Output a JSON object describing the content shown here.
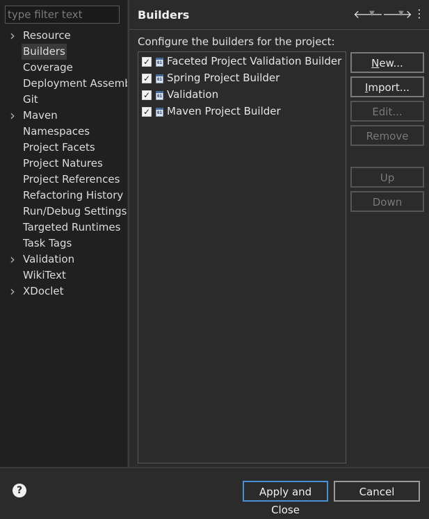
{
  "filter": {
    "placeholder": "type filter text"
  },
  "tree": {
    "items": [
      {
        "label": "Resource",
        "expandable": true
      },
      {
        "label": "Builders",
        "expandable": false,
        "selected": true
      },
      {
        "label": "Coverage",
        "expandable": false
      },
      {
        "label": "Deployment Assemb",
        "expandable": false
      },
      {
        "label": "Git",
        "expandable": false
      },
      {
        "label": "Maven",
        "expandable": true
      },
      {
        "label": "Namespaces",
        "expandable": false
      },
      {
        "label": "Project Facets",
        "expandable": false
      },
      {
        "label": "Project Natures",
        "expandable": false
      },
      {
        "label": "Project References",
        "expandable": false
      },
      {
        "label": "Refactoring History",
        "expandable": false
      },
      {
        "label": "Run/Debug Settings",
        "expandable": false
      },
      {
        "label": "Targeted Runtimes",
        "expandable": false
      },
      {
        "label": "Task Tags",
        "expandable": false
      },
      {
        "label": "Validation",
        "expandable": true
      },
      {
        "label": "WikiText",
        "expandable": false
      },
      {
        "label": "XDoclet",
        "expandable": true
      }
    ]
  },
  "page": {
    "title": "Builders",
    "description": "Configure the builders for the project:"
  },
  "builders": [
    {
      "label": "Faceted Project Validation Builder",
      "checked": true,
      "icon": "builder-icon"
    },
    {
      "label": "Spring Project Builder",
      "checked": true,
      "icon": "builder-icon"
    },
    {
      "label": "Validation",
      "checked": true,
      "icon": "builder-icon"
    },
    {
      "label": "Maven Project Builder",
      "checked": true,
      "icon": "builder-icon"
    }
  ],
  "buttons": {
    "new": {
      "label": "New...",
      "mnemonic": "N",
      "rest": "ew...",
      "enabled": true
    },
    "import": {
      "label": "Import...",
      "mnemonic": "I",
      "rest": "mport...",
      "enabled": true
    },
    "edit": {
      "label": "Edit...",
      "enabled": false
    },
    "remove": {
      "label": "Remove",
      "enabled": false
    },
    "up": {
      "label": "Up",
      "enabled": false
    },
    "down": {
      "label": "Down",
      "enabled": false
    }
  },
  "dialog": {
    "apply_close": "Apply and Close",
    "cancel": "Cancel",
    "help": "?"
  },
  "colors": {
    "accent": "#4a90d9",
    "background": "#2b2b2b",
    "sidebar": "#202020"
  }
}
